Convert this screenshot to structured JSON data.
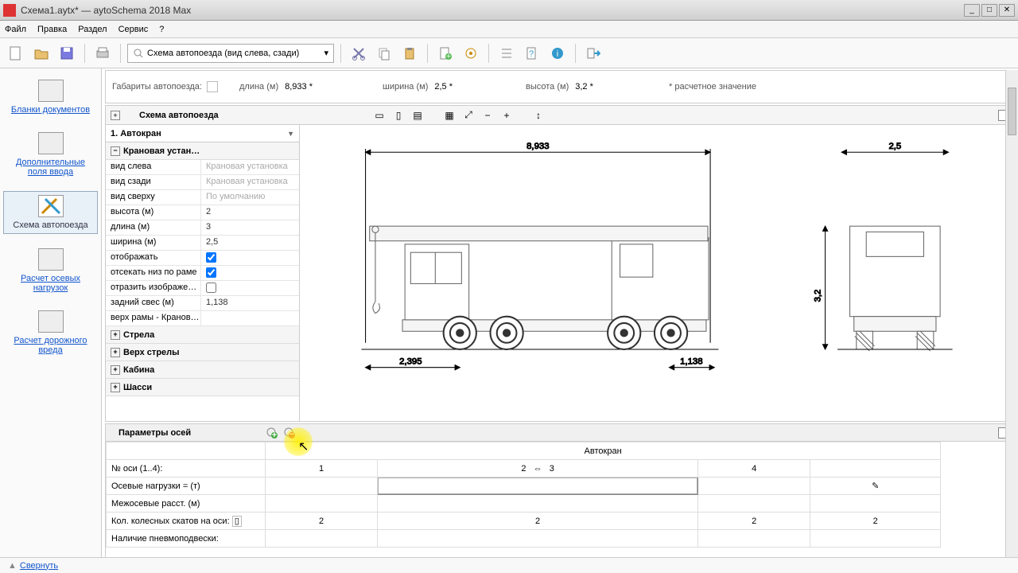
{
  "window": {
    "title": "Схема1.aytx*  —  aytoSchema 2018 Max"
  },
  "menu": [
    "Файл",
    "Правка",
    "Раздел",
    "Сервис",
    "?"
  ],
  "toolbar_dropdown": {
    "text": "Схема автопоезда (вид слева, сзади)"
  },
  "leftnav": [
    {
      "label": "Бланки документов",
      "active": false
    },
    {
      "label": "Дополнительные поля ввода",
      "active": false
    },
    {
      "label": "Схема автопоезда",
      "active": true
    },
    {
      "label": "Расчет осевых нагрузок",
      "active": false
    },
    {
      "label": "Расчет дорожного вреда",
      "active": false
    }
  ],
  "dims": {
    "label": "Габариты автопоезда:",
    "length_lbl": "длина (м)",
    "length": "8,933 *",
    "width_lbl": "ширина (м)",
    "width": "2,5 *",
    "height_lbl": "высота (м)",
    "height": "3,2 *",
    "note": "* расчетное значение"
  },
  "schema_panel_title": "Схема автопоезда",
  "props": {
    "selector": "1. Автокран",
    "group": "Крановая устан…",
    "rows": [
      {
        "k": "вид слева",
        "v": "Крановая установка",
        "grey": true
      },
      {
        "k": "вид сзади",
        "v": "Крановая установка",
        "grey": true
      },
      {
        "k": "вид сверху",
        "v": "По умолчанию",
        "grey": true
      },
      {
        "k": "высота (м)",
        "v": "2"
      },
      {
        "k": "длина (м)",
        "v": "3"
      },
      {
        "k": "ширина (м)",
        "v": "2,5"
      },
      {
        "k": "отображать",
        "v": "",
        "check": true,
        "checked": true
      },
      {
        "k": "отсекать низ по раме",
        "v": "",
        "check": true,
        "checked": true
      },
      {
        "k": "отразить изображе…",
        "v": "",
        "check": true,
        "checked": false
      },
      {
        "k": "задний свес (м)",
        "v": "1,138"
      },
      {
        "k": "верх рамы - Кранов…",
        "v": ""
      }
    ],
    "groups_after": [
      "Стрела",
      "Верх стрелы",
      "Кабина",
      "Шасси"
    ]
  },
  "drawing_dims": {
    "total": "8,933",
    "front": "2,395",
    "rear": "1,138",
    "width": "2,5",
    "height": "3,2"
  },
  "axle": {
    "title": "Параметры осей",
    "vehicle": "Автокран",
    "row_axisno": "№ оси (1..4):",
    "row_loads": "Осевые нагрузки  =  (т)",
    "row_spacing": "Межосевые расст. (м)",
    "row_wheels": "Кол. колесных скатов на оси:",
    "row_pneumo": "Наличие пневмоподвески:",
    "cols": [
      "1",
      "2",
      "3",
      "4"
    ],
    "wheels": [
      "2",
      "2",
      "2",
      "2"
    ]
  },
  "footer": {
    "collapse": "Свернуть"
  }
}
